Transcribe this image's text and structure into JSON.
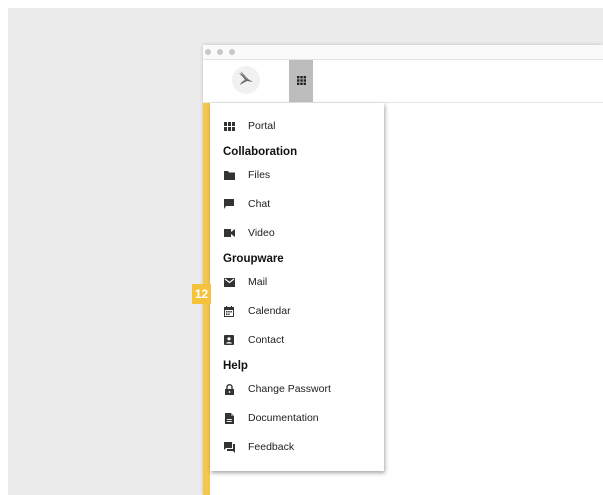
{
  "menu": {
    "portal": "Portal",
    "collaboration_heading": "Collaboration",
    "files": "Files",
    "chat": "Chat",
    "video": "Video",
    "groupware_heading": "Groupware",
    "mail": "Mail",
    "calendar": "Calendar",
    "contact": "Contact",
    "help_heading": "Help",
    "change_password": "Change Passwort",
    "documentation": "Documentation",
    "feedback": "Feedback"
  },
  "badge": {
    "label": "12"
  },
  "colors": {
    "accent": "#f5c74d",
    "badge": "#f5c23b",
    "apps_button": "#bdbdbd"
  },
  "icons": {
    "logo": "bird-logo",
    "apps": "grid-icon",
    "portal": "grid-icon",
    "files": "folder-icon",
    "chat": "chat-icon",
    "video": "video-icon",
    "mail": "mail-icon",
    "calendar": "calendar-icon",
    "contact": "contact-icon",
    "change_password": "lock-icon",
    "documentation": "document-icon",
    "feedback": "feedback-icon"
  }
}
